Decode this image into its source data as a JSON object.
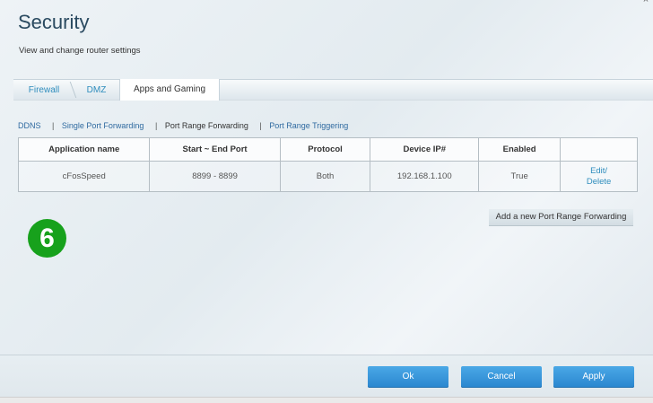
{
  "header": {
    "title": "Security",
    "subtitle": "View and change router settings",
    "close_glyph": "×"
  },
  "tabs": [
    {
      "label": "Firewall",
      "active": false
    },
    {
      "label": "DMZ",
      "active": false
    },
    {
      "label": "Apps and Gaming",
      "active": true
    }
  ],
  "subnav": {
    "items": [
      {
        "label": "DDNS",
        "current": false
      },
      {
        "label": "Single Port Forwarding",
        "current": false
      },
      {
        "label": "Port Range Forwarding",
        "current": true
      },
      {
        "label": "Port Range Triggering",
        "current": false
      }
    ],
    "separator": "|"
  },
  "table": {
    "columns": [
      "Application name",
      "Start ~ End Port",
      "Protocol",
      "Device IP#",
      "Enabled",
      ""
    ],
    "rows": [
      {
        "app": "cFosSpeed",
        "ports": "8899 - 8899",
        "protocol": "Both",
        "ip": "192.168.1.100",
        "enabled": "True",
        "edit": "Edit/",
        "delete": "Delete"
      }
    ]
  },
  "add_button_label": "Add a new Port Range Forwarding",
  "step_badge": "6",
  "footer": {
    "ok_label": "Ok",
    "cancel_label": "Cancel",
    "apply_label": "Apply"
  },
  "colors": {
    "link": "#2f8dbd",
    "primary_button": "#2a86cf",
    "badge": "#17a11c",
    "title": "#2a4a60"
  }
}
